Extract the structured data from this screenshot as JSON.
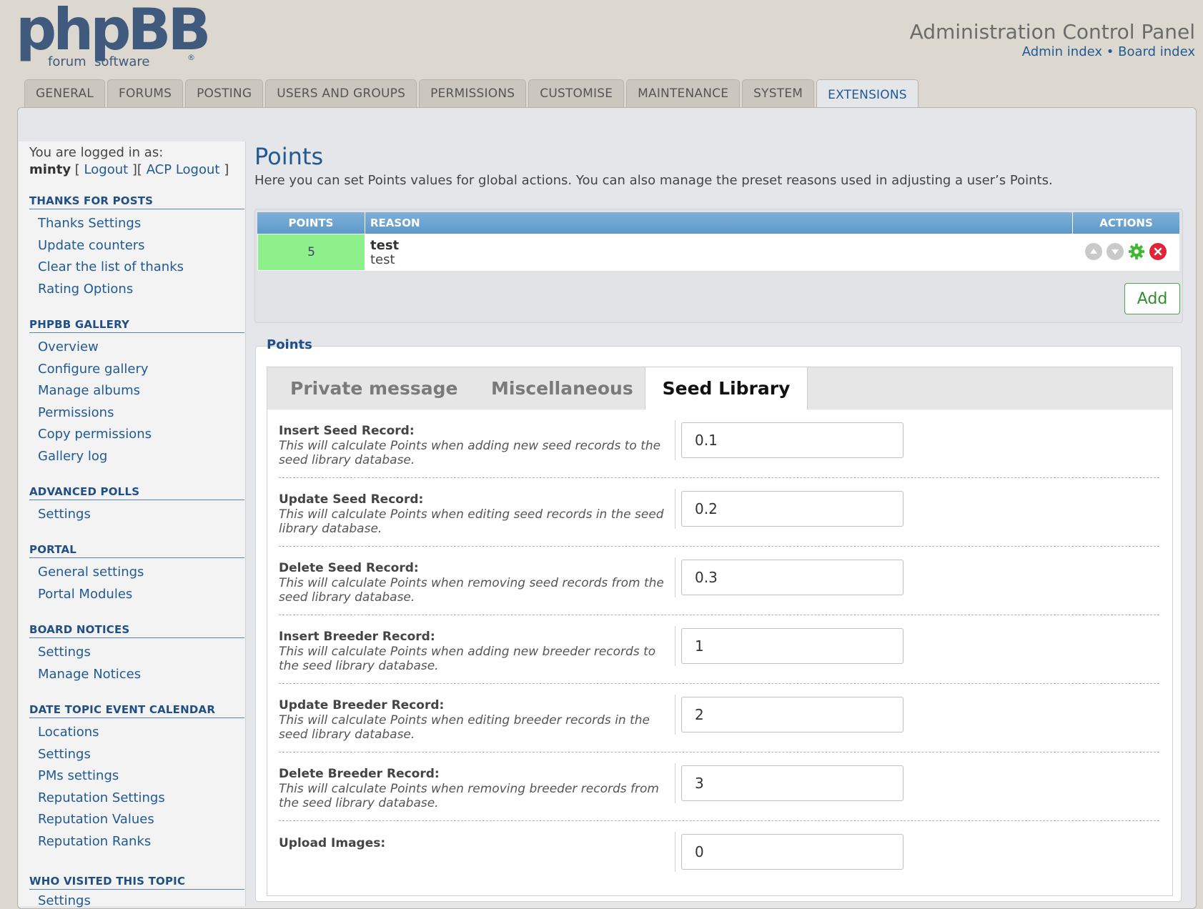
{
  "header": {
    "logo_main": "phpBB",
    "logo_sub": "forum  software",
    "logo_reg": "®",
    "acp_title": "Administration Control Panel",
    "admin_index": "Admin index",
    "separator": " • ",
    "board_index": "Board index"
  },
  "tabs": [
    "GENERAL",
    "FORUMS",
    "POSTING",
    "USERS AND GROUPS",
    "PERMISSIONS",
    "CUSTOMISE",
    "MAINTENANCE",
    "SYSTEM",
    "EXTENSIONS"
  ],
  "active_tab": "EXTENSIONS",
  "sidebar": {
    "logged_in_label": "You are logged in as:",
    "username": "minty",
    "logout": "Logout",
    "acp_logout": "ACP Logout",
    "sections": [
      {
        "title": "THANKS FOR POSTS",
        "items": [
          "Thanks Settings",
          "Update counters",
          "Clear the list of thanks",
          "Rating Options"
        ]
      },
      {
        "title": "PHPBB GALLERY",
        "items": [
          "Overview",
          "Configure gallery",
          "Manage albums",
          "Permissions",
          "Copy permissions",
          "Gallery log"
        ]
      },
      {
        "title": "ADVANCED POLLS",
        "items": [
          "Settings"
        ]
      },
      {
        "title": "PORTAL",
        "items": [
          "General settings",
          "Portal Modules"
        ]
      },
      {
        "title": "BOARD NOTICES",
        "items": [
          "Settings",
          "Manage Notices"
        ]
      },
      {
        "title": "DATE TOPIC EVENT CALENDAR",
        "items": [
          "Locations",
          "Settings",
          "PMs settings",
          "Reputation Settings",
          "Reputation Values",
          "Reputation Ranks"
        ]
      },
      {
        "title": "WHO VISITED THIS TOPIC",
        "items": [
          "Settings"
        ]
      }
    ]
  },
  "main": {
    "title": "Points",
    "description": "Here you can set Points values for global actions. You can also manage the preset reasons used in adjusting a user’s Points.",
    "table": {
      "headers": [
        "POINTS",
        "REASON",
        "ACTIONS"
      ],
      "rows": [
        {
          "points": "5",
          "reason_title": "test",
          "reason_desc": "test"
        }
      ]
    },
    "add_button": "Add",
    "fieldset_legend": "Points",
    "content_tabs": [
      "Private message",
      "Miscellaneous",
      "Seed Library"
    ],
    "active_content_tab": "Seed Library",
    "fields": [
      {
        "label": "Insert Seed Record:",
        "desc": "This will calculate Points when adding new seed records to the seed library database.",
        "value": "0.1"
      },
      {
        "label": "Update Seed Record:",
        "desc": "This will calculate Points when editing seed records in the seed library database.",
        "value": "0.2"
      },
      {
        "label": "Delete Seed Record:",
        "desc": "This will calculate Points when removing seed records from the seed library database.",
        "value": "0.3"
      },
      {
        "label": "Insert Breeder Record:",
        "desc": "This will calculate Points when adding new breeder records to the seed library database.",
        "value": "1"
      },
      {
        "label": "Update Breeder Record:",
        "desc": "This will calculate Points when editing breeder records in the seed library database.",
        "value": "2"
      },
      {
        "label": "Delete Breeder Record:",
        "desc": "This will calculate Points when removing breeder records from the seed library database.",
        "value": "3"
      },
      {
        "label": "Upload Images:",
        "desc": "",
        "value": "0"
      }
    ]
  },
  "colors": {
    "link": "#215a93",
    "header_bg": "#5d98c8",
    "points_cell": "#8ef08a",
    "add_border": "#4ca74c"
  },
  "icons": {
    "move_up": "arrow-up-icon",
    "move_down": "arrow-down-icon",
    "edit": "gear-icon",
    "delete": "delete-icon"
  }
}
